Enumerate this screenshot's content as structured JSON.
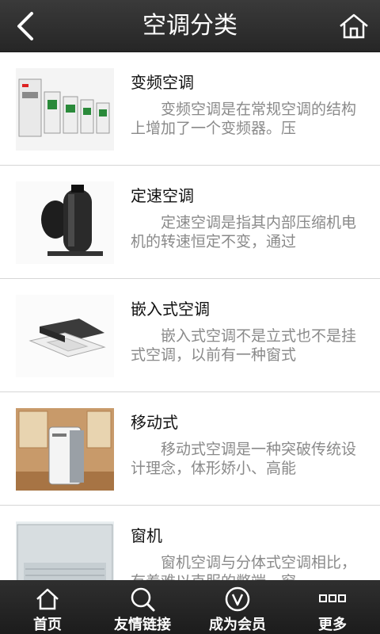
{
  "header": {
    "title": "空调分类",
    "back_icon": "chevron-left-icon",
    "home_icon": "home-icon"
  },
  "items": [
    {
      "title": "变频空调",
      "description": "变频空调是在常规空调的结构上增加了一个变频器。压",
      "image": "inverter-units-image"
    },
    {
      "title": "定速空调",
      "description": "定速空调是指其内部压缩机电机的转速恒定不变，通过",
      "image": "compressor-image"
    },
    {
      "title": "嵌入式空调",
      "description": "嵌入式空调不是立式也不是挂式空调，以前有一种窗式",
      "image": "cassette-ac-image"
    },
    {
      "title": "移动式",
      "description": "移动式空调是一种突破传统设计理念，体形娇小、高能",
      "image": "portable-ac-image"
    },
    {
      "title": "窗机",
      "description": "窗机空调与分体式空调相比，有着难以克服的弊端，窗",
      "image": "window-ac-image"
    }
  ],
  "tabbar": [
    {
      "label": "首页",
      "icon": "home-icon"
    },
    {
      "label": "友情链接",
      "icon": "search-icon"
    },
    {
      "label": "成为会员",
      "icon": "vip-icon"
    },
    {
      "label": "更多",
      "icon": "more-icon"
    }
  ],
  "colors": {
    "header_bg": "#2b2b2b",
    "tabbar_bg": "#222222",
    "description": "#8a8a8a"
  }
}
